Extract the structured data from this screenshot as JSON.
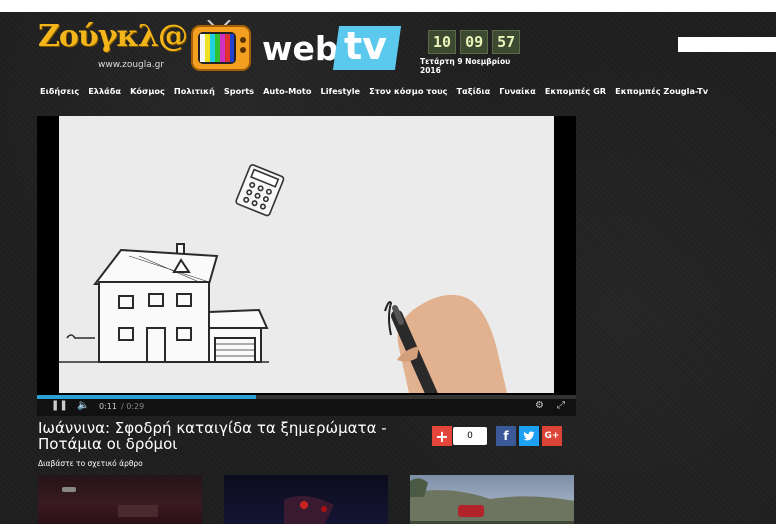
{
  "header": {
    "logo_text": "Ζούγκλ@",
    "logo_url": "www.zougla.gr",
    "web_label": "web",
    "tv_label": "tv",
    "clock": {
      "h": "10",
      "m": "09",
      "s": "57",
      "date": "Τετάρτη 9 Νοεμβρίου 2016"
    }
  },
  "nav": {
    "items": [
      "Ειδήσεις",
      "Ελλάδα",
      "Κόσμος",
      "Πολιτική",
      "Sports",
      "Auto-Moto",
      "Lifestyle",
      "Στον κόσμο τους",
      "Ταξίδια",
      "Γυναίκα",
      "Εκπομπές GR",
      "Εκπομπές Zougla-Tv"
    ]
  },
  "video": {
    "current_time": "0:11",
    "duration": "/ 0:29",
    "progress_fraction": 0.406,
    "title": "Ιωάννινα: Σφοδρή καταιγίδα τα ξημερώματα - Ποτάμια οι δρόμοι"
  },
  "share": {
    "count": "0",
    "gplus_label": "G+"
  },
  "related": {
    "label": "Διαβάστε το σχετικό άρθρο"
  },
  "colors": {
    "accent": "#2aa0d6",
    "logo": "#f2b51a",
    "facebook": "#3b5998",
    "twitter": "#1da1f2",
    "plus": "#e4463c"
  }
}
